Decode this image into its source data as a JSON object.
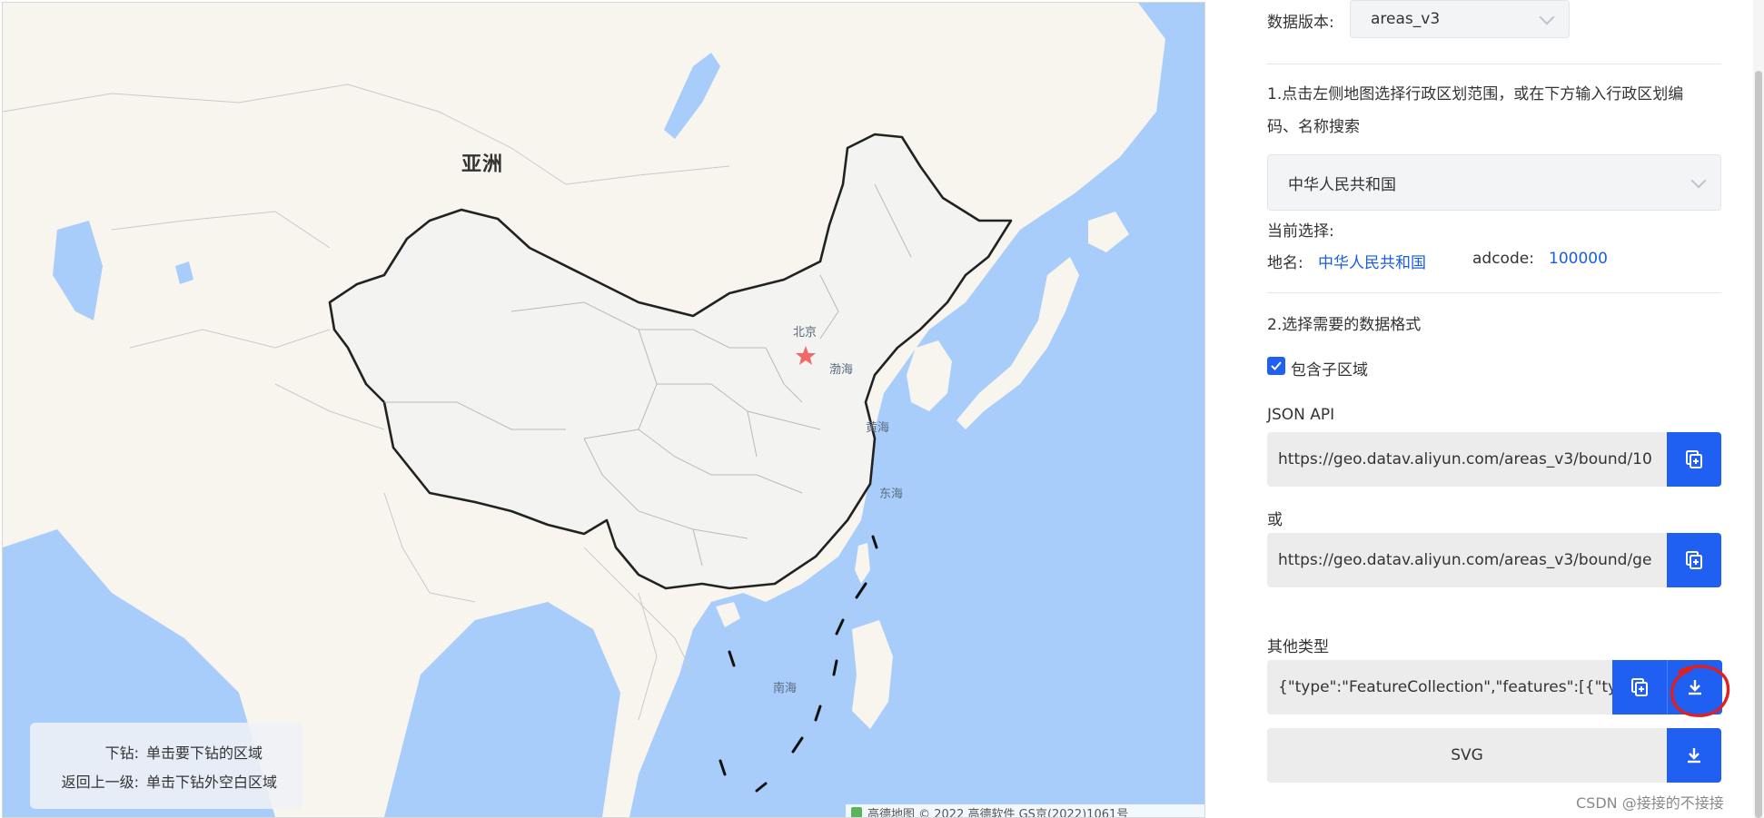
{
  "map": {
    "continent_label": "亚洲",
    "labels": {
      "beijing": "北京",
      "bohai": "渤海",
      "huanghai": "黄海",
      "donghai": "东海",
      "nanhai": "南海"
    },
    "legend": {
      "drill_key": "下钻:",
      "drill_value": "单击要下钻的区域",
      "back_key": "返回上一级:",
      "back_value": "单击下钻外空白区域"
    },
    "attribution": "高德地图 © 2022 高德软件 GS京(2022)1061号"
  },
  "panel": {
    "version_label": "数据版本:",
    "version_value": "areas_v3",
    "step1_text": "1.点击左侧地图选择行政区划范围，或在下方输入行政区划编码、名称搜索",
    "region_select_value": "中华人民共和国",
    "current_selection_label": "当前选择:",
    "place_name_label": "地名:",
    "place_name_value": "中华人民共和国",
    "adcode_label": "adcode:",
    "adcode_value": "100000",
    "step2_text": "2.选择需要的数据格式",
    "include_sub_label": "包含子区域",
    "json_api_label": "JSON API",
    "json_api_url": "https://geo.datav.aliyun.com/areas_v3/bound/10",
    "or_label": "或",
    "geojson_url": "https://geo.datav.aliyun.com/areas_v3/bound/ge",
    "other_types_label": "其他类型",
    "other_json_value": "{\"type\":\"FeatureCollection\",\"features\":[{\"typ",
    "svg_label": "SVG"
  },
  "watermark": "CSDN @接接的不接接",
  "colors": {
    "accent": "#1f5ff2",
    "link": "#1a5ce6",
    "sea": "#a9cdfb",
    "land": "#f8f5ee",
    "annotation": "#e02020"
  },
  "icons": {
    "copy": "copy-icon",
    "download": "download-icon",
    "chevron": "chevron-down-icon",
    "check": "check-icon"
  }
}
